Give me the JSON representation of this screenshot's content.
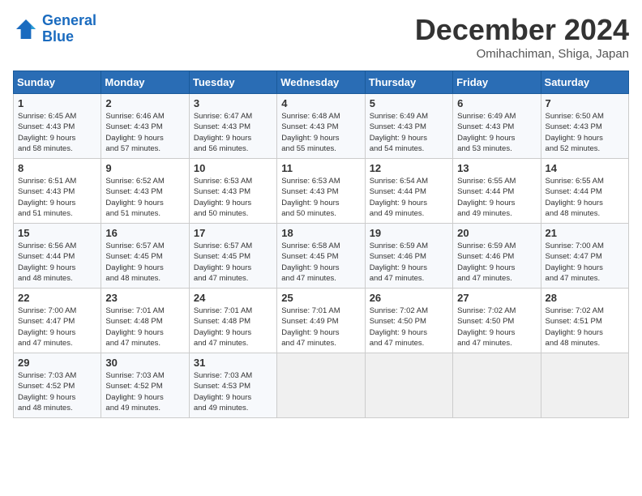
{
  "header": {
    "logo_line1": "General",
    "logo_line2": "Blue",
    "month": "December 2024",
    "location": "Omihachiman, Shiga, Japan"
  },
  "days_of_week": [
    "Sunday",
    "Monday",
    "Tuesday",
    "Wednesday",
    "Thursday",
    "Friday",
    "Saturday"
  ],
  "weeks": [
    [
      {
        "day": "1",
        "sunrise": "6:45 AM",
        "sunset": "4:43 PM",
        "daylight": "9 hours and 58 minutes."
      },
      {
        "day": "2",
        "sunrise": "6:46 AM",
        "sunset": "4:43 PM",
        "daylight": "9 hours and 57 minutes."
      },
      {
        "day": "3",
        "sunrise": "6:47 AM",
        "sunset": "4:43 PM",
        "daylight": "9 hours and 56 minutes."
      },
      {
        "day": "4",
        "sunrise": "6:48 AM",
        "sunset": "4:43 PM",
        "daylight": "9 hours and 55 minutes."
      },
      {
        "day": "5",
        "sunrise": "6:49 AM",
        "sunset": "4:43 PM",
        "daylight": "9 hours and 54 minutes."
      },
      {
        "day": "6",
        "sunrise": "6:49 AM",
        "sunset": "4:43 PM",
        "daylight": "9 hours and 53 minutes."
      },
      {
        "day": "7",
        "sunrise": "6:50 AM",
        "sunset": "4:43 PM",
        "daylight": "9 hours and 52 minutes."
      }
    ],
    [
      {
        "day": "8",
        "sunrise": "6:51 AM",
        "sunset": "4:43 PM",
        "daylight": "9 hours and 51 minutes."
      },
      {
        "day": "9",
        "sunrise": "6:52 AM",
        "sunset": "4:43 PM",
        "daylight": "9 hours and 51 minutes."
      },
      {
        "day": "10",
        "sunrise": "6:53 AM",
        "sunset": "4:43 PM",
        "daylight": "9 hours and 50 minutes."
      },
      {
        "day": "11",
        "sunrise": "6:53 AM",
        "sunset": "4:43 PM",
        "daylight": "9 hours and 50 minutes."
      },
      {
        "day": "12",
        "sunrise": "6:54 AM",
        "sunset": "4:44 PM",
        "daylight": "9 hours and 49 minutes."
      },
      {
        "day": "13",
        "sunrise": "6:55 AM",
        "sunset": "4:44 PM",
        "daylight": "9 hours and 49 minutes."
      },
      {
        "day": "14",
        "sunrise": "6:55 AM",
        "sunset": "4:44 PM",
        "daylight": "9 hours and 48 minutes."
      }
    ],
    [
      {
        "day": "15",
        "sunrise": "6:56 AM",
        "sunset": "4:44 PM",
        "daylight": "9 hours and 48 minutes."
      },
      {
        "day": "16",
        "sunrise": "6:57 AM",
        "sunset": "4:45 PM",
        "daylight": "9 hours and 48 minutes."
      },
      {
        "day": "17",
        "sunrise": "6:57 AM",
        "sunset": "4:45 PM",
        "daylight": "9 hours and 47 minutes."
      },
      {
        "day": "18",
        "sunrise": "6:58 AM",
        "sunset": "4:45 PM",
        "daylight": "9 hours and 47 minutes."
      },
      {
        "day": "19",
        "sunrise": "6:59 AM",
        "sunset": "4:46 PM",
        "daylight": "9 hours and 47 minutes."
      },
      {
        "day": "20",
        "sunrise": "6:59 AM",
        "sunset": "4:46 PM",
        "daylight": "9 hours and 47 minutes."
      },
      {
        "day": "21",
        "sunrise": "7:00 AM",
        "sunset": "4:47 PM",
        "daylight": "9 hours and 47 minutes."
      }
    ],
    [
      {
        "day": "22",
        "sunrise": "7:00 AM",
        "sunset": "4:47 PM",
        "daylight": "9 hours and 47 minutes."
      },
      {
        "day": "23",
        "sunrise": "7:01 AM",
        "sunset": "4:48 PM",
        "daylight": "9 hours and 47 minutes."
      },
      {
        "day": "24",
        "sunrise": "7:01 AM",
        "sunset": "4:48 PM",
        "daylight": "9 hours and 47 minutes."
      },
      {
        "day": "25",
        "sunrise": "7:01 AM",
        "sunset": "4:49 PM",
        "daylight": "9 hours and 47 minutes."
      },
      {
        "day": "26",
        "sunrise": "7:02 AM",
        "sunset": "4:50 PM",
        "daylight": "9 hours and 47 minutes."
      },
      {
        "day": "27",
        "sunrise": "7:02 AM",
        "sunset": "4:50 PM",
        "daylight": "9 hours and 47 minutes."
      },
      {
        "day": "28",
        "sunrise": "7:02 AM",
        "sunset": "4:51 PM",
        "daylight": "9 hours and 48 minutes."
      }
    ],
    [
      {
        "day": "29",
        "sunrise": "7:03 AM",
        "sunset": "4:52 PM",
        "daylight": "9 hours and 48 minutes."
      },
      {
        "day": "30",
        "sunrise": "7:03 AM",
        "sunset": "4:52 PM",
        "daylight": "9 hours and 49 minutes."
      },
      {
        "day": "31",
        "sunrise": "7:03 AM",
        "sunset": "4:53 PM",
        "daylight": "9 hours and 49 minutes."
      },
      null,
      null,
      null,
      null
    ]
  ]
}
